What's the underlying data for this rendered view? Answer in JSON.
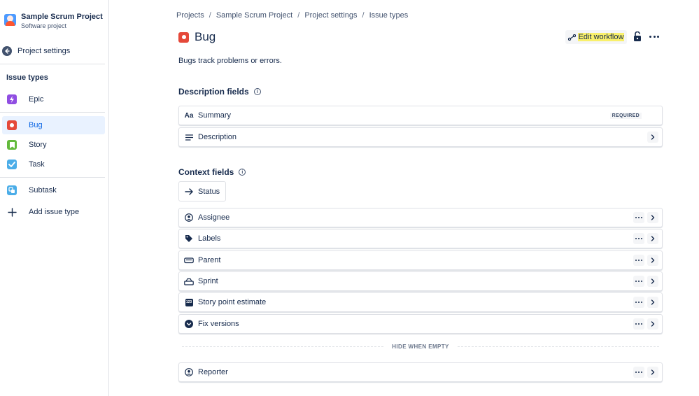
{
  "sidebar": {
    "project_name": "Sample Scrum Project",
    "project_type": "Software project",
    "back_label": "Project settings",
    "section_title": "Issue types",
    "items": [
      {
        "label": "Epic",
        "icon": "epic-icon",
        "color": "#904ee2"
      },
      {
        "label": "Bug",
        "icon": "bug-icon",
        "color": "#e5493a",
        "active": true
      },
      {
        "label": "Story",
        "icon": "story-icon",
        "color": "#63ba3c"
      },
      {
        "label": "Task",
        "icon": "task-icon",
        "color": "#4bade8"
      },
      {
        "label": "Subtask",
        "icon": "subtask-icon",
        "color": "#4bade8"
      },
      {
        "label": "Add issue type",
        "icon": "plus-icon"
      }
    ]
  },
  "breadcrumb": [
    "Projects",
    "Sample Scrum Project",
    "Project settings",
    "Issue types"
  ],
  "header": {
    "title": "Bug",
    "edit_workflow_label": "Edit workflow",
    "description": "Bugs track problems or errors."
  },
  "description_fields": {
    "heading": "Description fields",
    "fields": [
      {
        "label": "Summary",
        "icon": "text-format-icon",
        "badge": "REQUIRED"
      },
      {
        "label": "Description",
        "icon": "paragraph-icon"
      }
    ]
  },
  "context_fields": {
    "heading": "Context fields",
    "status_label": "Status",
    "fields": [
      {
        "label": "Assignee",
        "icon": "person-icon"
      },
      {
        "label": "Labels",
        "icon": "label-icon"
      },
      {
        "label": "Parent",
        "icon": "parent-icon"
      },
      {
        "label": "Sprint",
        "icon": "sprint-icon"
      },
      {
        "label": "Story point estimate",
        "icon": "number-icon"
      },
      {
        "label": "Fix versions",
        "icon": "version-icon"
      }
    ],
    "hide_when_empty_label": "HIDE WHEN EMPTY",
    "hidden_fields": [
      {
        "label": "Reporter",
        "icon": "person-icon"
      }
    ]
  },
  "colors": {
    "accent": "#0c66e4",
    "active_bg": "#e9f2ff",
    "highlight": "#f9f06b"
  }
}
